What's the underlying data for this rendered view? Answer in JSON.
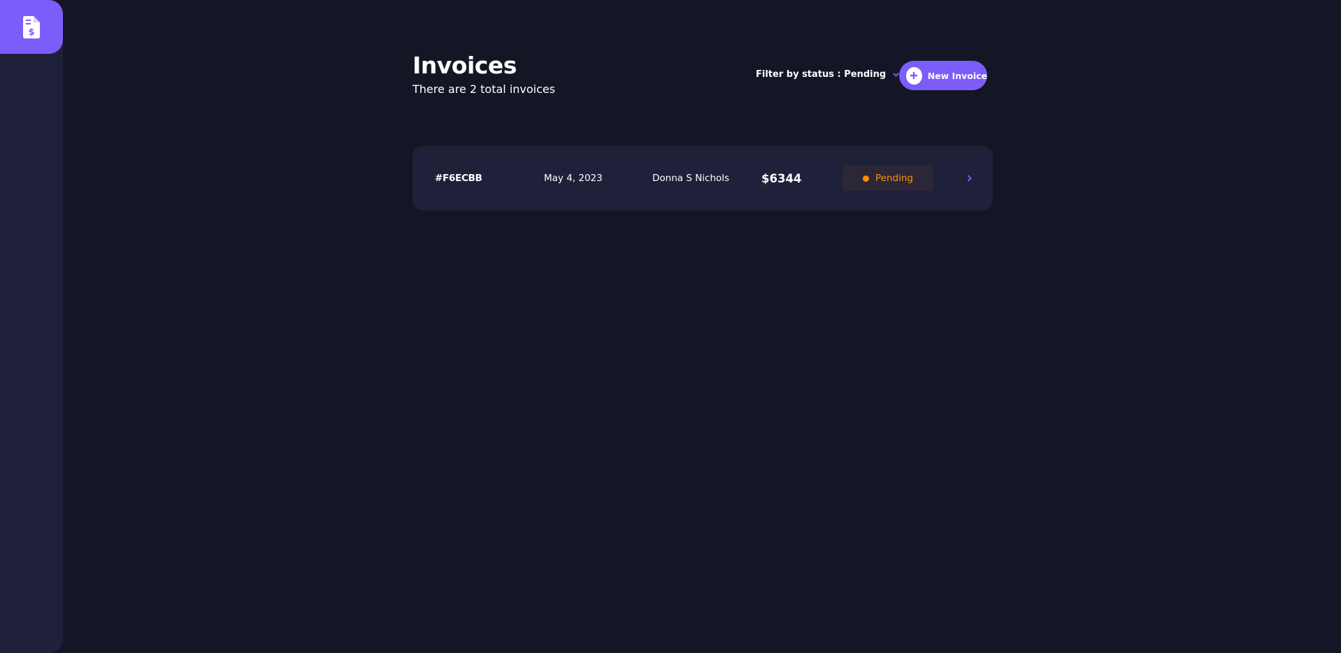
{
  "header": {
    "title": "Invoices",
    "subtitle": "There are 2 total invoices",
    "filter_label": "Filter by status : Pending",
    "new_invoice_label": "New Invoice"
  },
  "invoices": [
    {
      "id": "#F6ECBB",
      "date": "May 4, 2023",
      "client": "Donna S Nichols",
      "amount": "$6344",
      "status": "Pending"
    }
  ],
  "colors": {
    "accent": "#7c5dfa",
    "background": "#141625",
    "surface": "#1e2139",
    "pending": "#ff8f00"
  },
  "icons": {
    "logo": "invoice-dollar-icon",
    "filter": "chevron-down-icon",
    "add": "plus-icon",
    "row": "chevron-right-icon"
  }
}
